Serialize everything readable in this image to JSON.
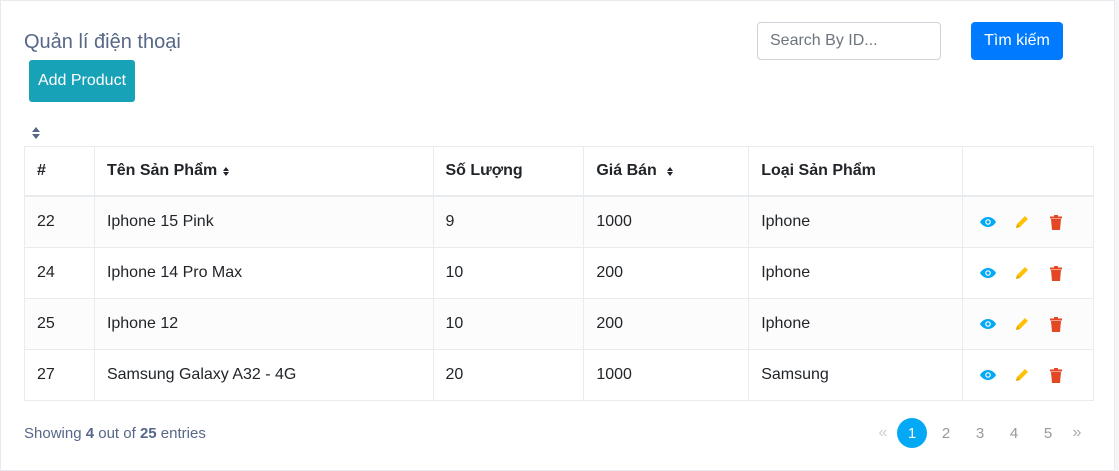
{
  "header": {
    "title": "Quản lí điện thoại",
    "add_label": "Add Product",
    "search_placeholder": "Search By ID...",
    "search_button": "Tìm kiếm"
  },
  "table": {
    "columns": [
      "#",
      "Tên Sản Phẩm",
      "Số Lượng",
      "Giá Bán",
      "Loại Sản Phẩm",
      ""
    ],
    "rows": [
      [
        "22",
        "Iphone 15 Pink",
        "9",
        "1000",
        "Iphone"
      ],
      [
        "24",
        "Iphone 14 Pro Max",
        "10",
        "200",
        "Iphone"
      ],
      [
        "25",
        "Iphone 12",
        "10",
        "200",
        "Iphone"
      ],
      [
        "27",
        "Samsung Galaxy A32 - 4G",
        "20",
        "1000",
        "Samsung"
      ]
    ],
    "action_icons": [
      "eye-icon",
      "pencil-icon",
      "trash-icon"
    ]
  },
  "footer": {
    "showing_prefix": "Showing",
    "shown": "4",
    "out_of": "out of",
    "total": "25",
    "entries": "entries"
  },
  "pagination": {
    "prev": "«",
    "pages": [
      "1",
      "2",
      "3",
      "4",
      "5"
    ],
    "next": "»",
    "current": "1"
  },
  "colors": {
    "view": "#03a9f4",
    "edit": "#ffc107",
    "delete": "#e34724",
    "add_button": "#17a2b8",
    "search_button": "#007bff"
  }
}
